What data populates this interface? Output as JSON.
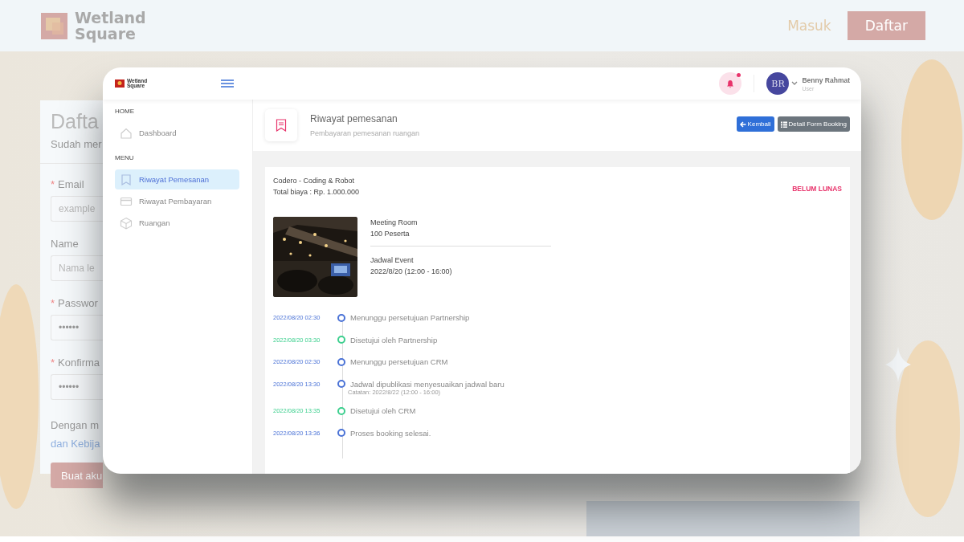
{
  "site_header": {
    "logo": "Wetland Square",
    "nav": [
      {
        "label": "Masuk",
        "kind": "link"
      },
      {
        "label": "Daftar",
        "kind": "button"
      }
    ]
  },
  "signup_form": {
    "title": "Dafta",
    "subtitle": "Sudah mer",
    "required_mark": "*",
    "fields": [
      {
        "label": "Email",
        "required": true,
        "placeholder": "example"
      },
      {
        "label": "Name",
        "required": false,
        "placeholder": "Nama le"
      },
      {
        "label": "Passwor",
        "required": true,
        "value": "••••••"
      },
      {
        "label": "Konfirma",
        "required": true,
        "value": "••••••"
      }
    ],
    "terms_text": "Dengan m",
    "terms_link": "dan Kebija",
    "submit": "Buat aku"
  },
  "app": {
    "logo": "Wetland Square",
    "notifications": {
      "unread": true
    },
    "user": {
      "initials": "BR",
      "name": "Benny Rahmat",
      "role": "User"
    },
    "sidebar": {
      "sections": [
        {
          "heading": "HOME",
          "items": [
            {
              "label": "Dashboard",
              "selected": false
            }
          ]
        },
        {
          "heading": "MENU",
          "items": [
            {
              "label": "Riwayat Pemesanan",
              "selected": true
            },
            {
              "label": "Riwayat Pembayaran",
              "selected": false
            },
            {
              "label": "Ruangan",
              "selected": false
            }
          ]
        }
      ]
    },
    "page_header": {
      "title": "Riwayat pemesanan",
      "subtitle": "Pembayaran pemesanan ruangan",
      "buttons": [
        {
          "label": "Kembali",
          "kind": "primary"
        },
        {
          "label": "Detail Form Booking",
          "kind": "secondary"
        }
      ]
    },
    "booking": {
      "name": "Codero - Coding & Robot",
      "total": "Total biaya : Rp. 1.000.000",
      "status": "BELUM LUNAS",
      "room": "Meeting Room",
      "capacity": "100 Peserta",
      "schedule_label": "Jadwal Event",
      "schedule": "2022/8/20 (12:00 - 16:00)",
      "timeline": [
        {
          "time": "2022/08/20 02:30",
          "text": "Menunggu persetujuan Partnership",
          "color": "#4a72d6"
        },
        {
          "time": "2022/08/20 03:30",
          "text": "Disetujui oleh Partnership",
          "color": "#3ccf8e"
        },
        {
          "time": "2022/08/20 02:30",
          "text": "Menunggu persetujuan CRM",
          "color": "#4a72d6"
        },
        {
          "time": "2022/08/20 13:30",
          "text": "Jadwal dipublikasi menyesuaikan jadwal baru",
          "note": "Catatan: 2022/8/22 (12:00 - 16:00)",
          "color": "#4a72d6"
        },
        {
          "time": "2022/08/20 13:35",
          "text": "Disetujui oleh CRM",
          "color": "#3ccf8e"
        },
        {
          "time": "2022/08/20 13:36",
          "text": "Proses booking selesai.",
          "color": "#4a72d6"
        }
      ]
    }
  }
}
